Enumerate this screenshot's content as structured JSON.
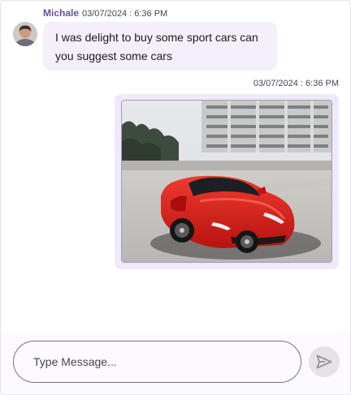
{
  "messages": {
    "incoming": {
      "sender": "Michale",
      "timestamp": "03/07/2024 : 6:36 PM",
      "text": "I was delight to buy some sport cars can you suggest some cars",
      "avatar_icon": "user-avatar"
    },
    "outgoing": {
      "timestamp": "03/07/2024 : 6:36 PM",
      "attachment": "red-sports-car-photo"
    }
  },
  "composer": {
    "placeholder": "Type Message...",
    "send_icon": "send-icon"
  },
  "colors": {
    "accent": "#6750a4",
    "bubble_incoming": "#f4eff8",
    "bubble_outgoing": "#efe9fb",
    "car_red": "#d81e1c"
  }
}
